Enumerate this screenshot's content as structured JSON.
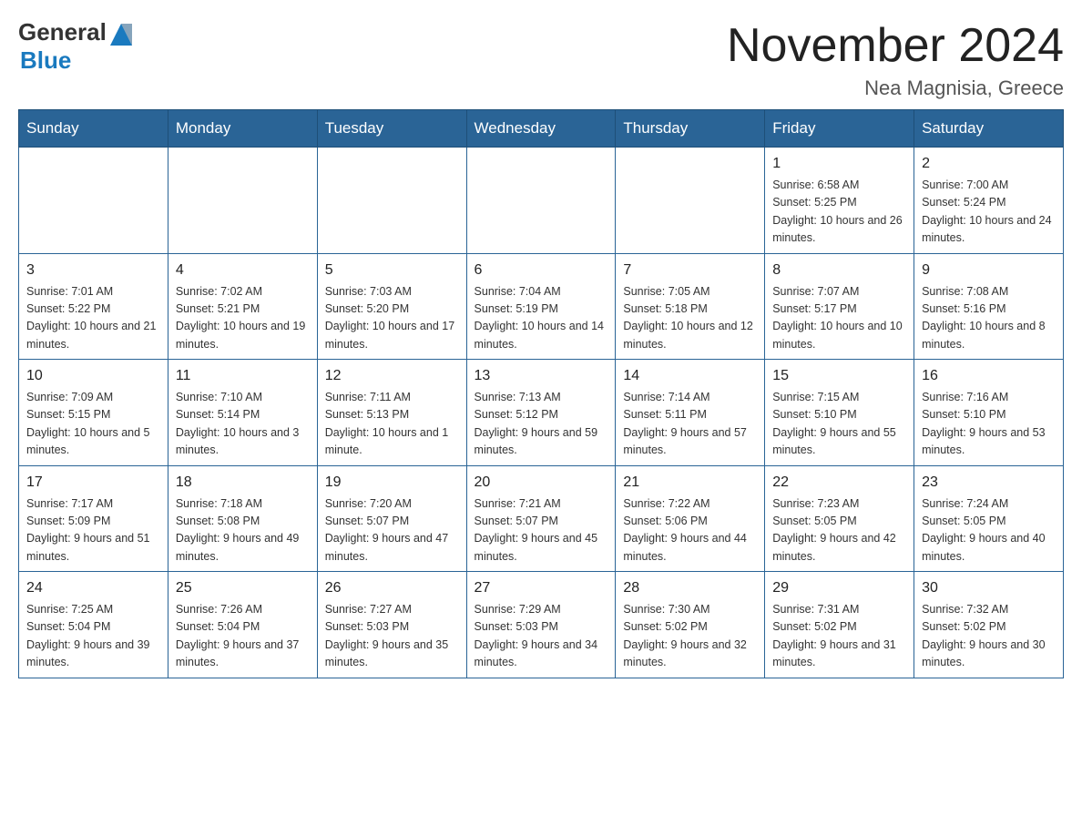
{
  "header": {
    "title": "November 2024",
    "subtitle": "Nea Magnisia, Greece",
    "logo_general": "General",
    "logo_blue": "Blue"
  },
  "days_of_week": [
    "Sunday",
    "Monday",
    "Tuesday",
    "Wednesday",
    "Thursday",
    "Friday",
    "Saturday"
  ],
  "weeks": [
    [
      {
        "day": "",
        "info": ""
      },
      {
        "day": "",
        "info": ""
      },
      {
        "day": "",
        "info": ""
      },
      {
        "day": "",
        "info": ""
      },
      {
        "day": "",
        "info": ""
      },
      {
        "day": "1",
        "info": "Sunrise: 6:58 AM\nSunset: 5:25 PM\nDaylight: 10 hours and 26 minutes."
      },
      {
        "day": "2",
        "info": "Sunrise: 7:00 AM\nSunset: 5:24 PM\nDaylight: 10 hours and 24 minutes."
      }
    ],
    [
      {
        "day": "3",
        "info": "Sunrise: 7:01 AM\nSunset: 5:22 PM\nDaylight: 10 hours and 21 minutes."
      },
      {
        "day": "4",
        "info": "Sunrise: 7:02 AM\nSunset: 5:21 PM\nDaylight: 10 hours and 19 minutes."
      },
      {
        "day": "5",
        "info": "Sunrise: 7:03 AM\nSunset: 5:20 PM\nDaylight: 10 hours and 17 minutes."
      },
      {
        "day": "6",
        "info": "Sunrise: 7:04 AM\nSunset: 5:19 PM\nDaylight: 10 hours and 14 minutes."
      },
      {
        "day": "7",
        "info": "Sunrise: 7:05 AM\nSunset: 5:18 PM\nDaylight: 10 hours and 12 minutes."
      },
      {
        "day": "8",
        "info": "Sunrise: 7:07 AM\nSunset: 5:17 PM\nDaylight: 10 hours and 10 minutes."
      },
      {
        "day": "9",
        "info": "Sunrise: 7:08 AM\nSunset: 5:16 PM\nDaylight: 10 hours and 8 minutes."
      }
    ],
    [
      {
        "day": "10",
        "info": "Sunrise: 7:09 AM\nSunset: 5:15 PM\nDaylight: 10 hours and 5 minutes."
      },
      {
        "day": "11",
        "info": "Sunrise: 7:10 AM\nSunset: 5:14 PM\nDaylight: 10 hours and 3 minutes."
      },
      {
        "day": "12",
        "info": "Sunrise: 7:11 AM\nSunset: 5:13 PM\nDaylight: 10 hours and 1 minute."
      },
      {
        "day": "13",
        "info": "Sunrise: 7:13 AM\nSunset: 5:12 PM\nDaylight: 9 hours and 59 minutes."
      },
      {
        "day": "14",
        "info": "Sunrise: 7:14 AM\nSunset: 5:11 PM\nDaylight: 9 hours and 57 minutes."
      },
      {
        "day": "15",
        "info": "Sunrise: 7:15 AM\nSunset: 5:10 PM\nDaylight: 9 hours and 55 minutes."
      },
      {
        "day": "16",
        "info": "Sunrise: 7:16 AM\nSunset: 5:10 PM\nDaylight: 9 hours and 53 minutes."
      }
    ],
    [
      {
        "day": "17",
        "info": "Sunrise: 7:17 AM\nSunset: 5:09 PM\nDaylight: 9 hours and 51 minutes."
      },
      {
        "day": "18",
        "info": "Sunrise: 7:18 AM\nSunset: 5:08 PM\nDaylight: 9 hours and 49 minutes."
      },
      {
        "day": "19",
        "info": "Sunrise: 7:20 AM\nSunset: 5:07 PM\nDaylight: 9 hours and 47 minutes."
      },
      {
        "day": "20",
        "info": "Sunrise: 7:21 AM\nSunset: 5:07 PM\nDaylight: 9 hours and 45 minutes."
      },
      {
        "day": "21",
        "info": "Sunrise: 7:22 AM\nSunset: 5:06 PM\nDaylight: 9 hours and 44 minutes."
      },
      {
        "day": "22",
        "info": "Sunrise: 7:23 AM\nSunset: 5:05 PM\nDaylight: 9 hours and 42 minutes."
      },
      {
        "day": "23",
        "info": "Sunrise: 7:24 AM\nSunset: 5:05 PM\nDaylight: 9 hours and 40 minutes."
      }
    ],
    [
      {
        "day": "24",
        "info": "Sunrise: 7:25 AM\nSunset: 5:04 PM\nDaylight: 9 hours and 39 minutes."
      },
      {
        "day": "25",
        "info": "Sunrise: 7:26 AM\nSunset: 5:04 PM\nDaylight: 9 hours and 37 minutes."
      },
      {
        "day": "26",
        "info": "Sunrise: 7:27 AM\nSunset: 5:03 PM\nDaylight: 9 hours and 35 minutes."
      },
      {
        "day": "27",
        "info": "Sunrise: 7:29 AM\nSunset: 5:03 PM\nDaylight: 9 hours and 34 minutes."
      },
      {
        "day": "28",
        "info": "Sunrise: 7:30 AM\nSunset: 5:02 PM\nDaylight: 9 hours and 32 minutes."
      },
      {
        "day": "29",
        "info": "Sunrise: 7:31 AM\nSunset: 5:02 PM\nDaylight: 9 hours and 31 minutes."
      },
      {
        "day": "30",
        "info": "Sunrise: 7:32 AM\nSunset: 5:02 PM\nDaylight: 9 hours and 30 minutes."
      }
    ]
  ]
}
